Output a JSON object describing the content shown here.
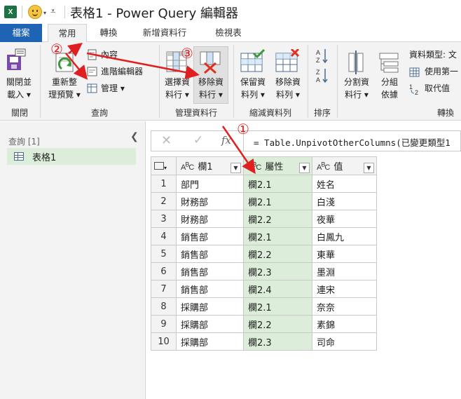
{
  "titlebar": {
    "app_icon": "X",
    "title": "表格1 - Power Query 編輯器"
  },
  "tabs": [
    {
      "label": "檔案"
    },
    {
      "label": "常用"
    },
    {
      "label": "轉換"
    },
    {
      "label": "新增資料行"
    },
    {
      "label": "檢視表"
    }
  ],
  "ribbon": {
    "close_group": {
      "label": "關閉",
      "close_load_line1": "關閉並",
      "close_load_line2": "載入 ▾"
    },
    "query_group": {
      "label": "查詢",
      "refresh_line1": "重新整",
      "refresh_line2": "理預覽 ▾",
      "properties": "內容",
      "advanced_editor": "進階編輯器",
      "manage": "管理 ▾"
    },
    "manage_columns_group": {
      "label": "管理資料行",
      "choose_line1": "選擇資",
      "choose_line2": "料行 ▾",
      "remove_line1": "移除資",
      "remove_line2": "料行 ▾"
    },
    "reduce_rows_group": {
      "label": "縮減資料列",
      "keep_line1": "保留資",
      "keep_line2": "料列 ▾",
      "removerows_line1": "移除資",
      "removerows_line2": "料列 ▾"
    },
    "sort_group": {
      "label": "排序"
    },
    "transform_group": {
      "label": "轉換",
      "split_line1": "分割資",
      "split_line2": "料行 ▾",
      "group_line1": "分組",
      "group_line2": "依據",
      "data_type": "資料類型: 文",
      "use_first": "使用第一",
      "replace": "取代值"
    }
  },
  "query_pane": {
    "header": "查詢 [1]",
    "items": [
      {
        "label": "表格1"
      }
    ]
  },
  "formula_bar": {
    "formula": "= Table.UnpivotOtherColumns(已變更類型1"
  },
  "grid": {
    "columns": [
      {
        "name": "欄1",
        "type": "ABC"
      },
      {
        "name": "屬性",
        "type": "ABC"
      },
      {
        "name": "值",
        "type": "ABC"
      }
    ],
    "rows": [
      {
        "n": "1",
        "c1": "部門",
        "c2": "欄2.1",
        "c3": "姓名"
      },
      {
        "n": "2",
        "c1": "財務部",
        "c2": "欄2.1",
        "c3": "白淺"
      },
      {
        "n": "3",
        "c1": "財務部",
        "c2": "欄2.2",
        "c3": "夜華"
      },
      {
        "n": "4",
        "c1": "銷售部",
        "c2": "欄2.1",
        "c3": "白鳳九"
      },
      {
        "n": "5",
        "c1": "銷售部",
        "c2": "欄2.2",
        "c3": "東華"
      },
      {
        "n": "6",
        "c1": "銷售部",
        "c2": "欄2.3",
        "c3": "墨淵"
      },
      {
        "n": "7",
        "c1": "銷售部",
        "c2": "欄2.4",
        "c3": "連宋"
      },
      {
        "n": "8",
        "c1": "採購部",
        "c2": "欄2.1",
        "c3": "奈奈"
      },
      {
        "n": "9",
        "c1": "採購部",
        "c2": "欄2.2",
        "c3": "素錦"
      },
      {
        "n": "10",
        "c1": "採購部",
        "c2": "欄2.3",
        "c3": "司命"
      }
    ]
  },
  "annotations": {
    "step1": "①",
    "step2": "②",
    "step3": "③",
    "color": "#e02020"
  }
}
